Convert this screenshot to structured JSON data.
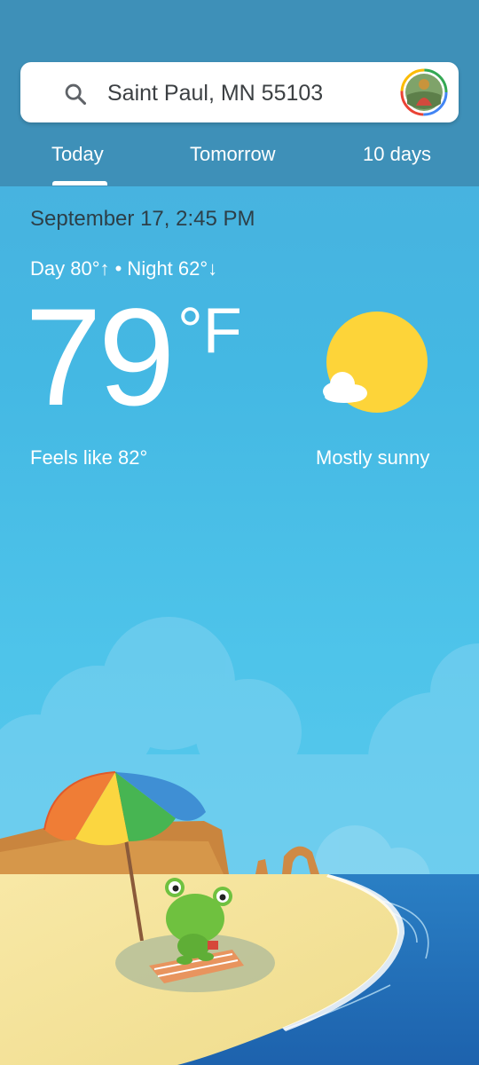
{
  "search": {
    "location": "Saint Paul, MN 55103",
    "icon": "search-icon"
  },
  "account": {
    "icon": "account-avatar"
  },
  "tabs": [
    {
      "label": "Today",
      "selected": true
    },
    {
      "label": "Tomorrow",
      "selected": false
    },
    {
      "label": "10 days",
      "selected": false
    }
  ],
  "current": {
    "date_time": "September 17, 2:45 PM",
    "day_night": "Day 80°↑ • Night 62°↓",
    "temperature": "79",
    "unit": "°F",
    "feels_like": "Feels like 82°",
    "condition": "Mostly sunny",
    "condition_icon": "sun-with-cloud-icon"
  },
  "colors": {
    "header": "#3e90b8",
    "sky": "#44b8e3",
    "sun": "#fdd439",
    "sea": "#1f6fb8",
    "sand": "#f6e5a0"
  }
}
